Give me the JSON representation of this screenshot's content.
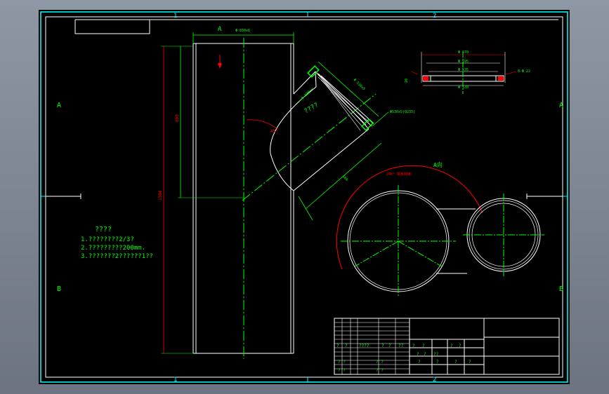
{
  "colors": {
    "background": "#000000",
    "frame": "#ffffff",
    "border": "#00ffff",
    "centerline": "#00ff00",
    "dimension": "#00ff00",
    "arc": "#ff0000",
    "outer_frame": "#888888"
  },
  "zones": {
    "top_left": "1",
    "top_right": "2",
    "bottom_left": "1",
    "bottom_right": "2",
    "left_top": "A",
    "left_bottom": "B",
    "right_top": "A",
    "right_bottom": "B"
  },
  "main_view": {
    "section_label": "A",
    "width_dim": "Φ 830x6",
    "height_dim_upper": "850",
    "height_dim_total": "1500",
    "angle_dim": "45°",
    "branch_dim_len": "Φ 530x5",
    "branch_dim_dia": "Φ 630",
    "branch_label": "????",
    "side_dim": "600",
    "flange_note": "Φ530x5(Q235)"
  },
  "section_view": {
    "title": "A向",
    "arc_label": "240° 钢板封堵",
    "icon": "pipe-section-icon"
  },
  "flange_detail": {
    "dims": [
      "Φ 670",
      "Φ 595",
      "Φ 535",
      "Φ 530"
    ],
    "note": "8-Φ 22",
    "thickness": "20",
    "icon": "flange-icon"
  },
  "notes": {
    "heading": "????",
    "line1": "1.????????2/3?",
    "line2": "2.?????????200mm.",
    "line3": "3.???????2??????1??"
  },
  "title_block": {
    "row1": [
      "?",
      "?",
      "????",
      "?",
      "?",
      "??"
    ],
    "row2": [
      "?",
      "?",
      "?",
      "?"
    ],
    "row3": [
      "?",
      "?",
      "??",
      "?",
      "?",
      "?",
      "?"
    ],
    "row4": [
      "? ?",
      "? ?"
    ],
    "mid": [
      "? ?",
      "? ?"
    ]
  }
}
